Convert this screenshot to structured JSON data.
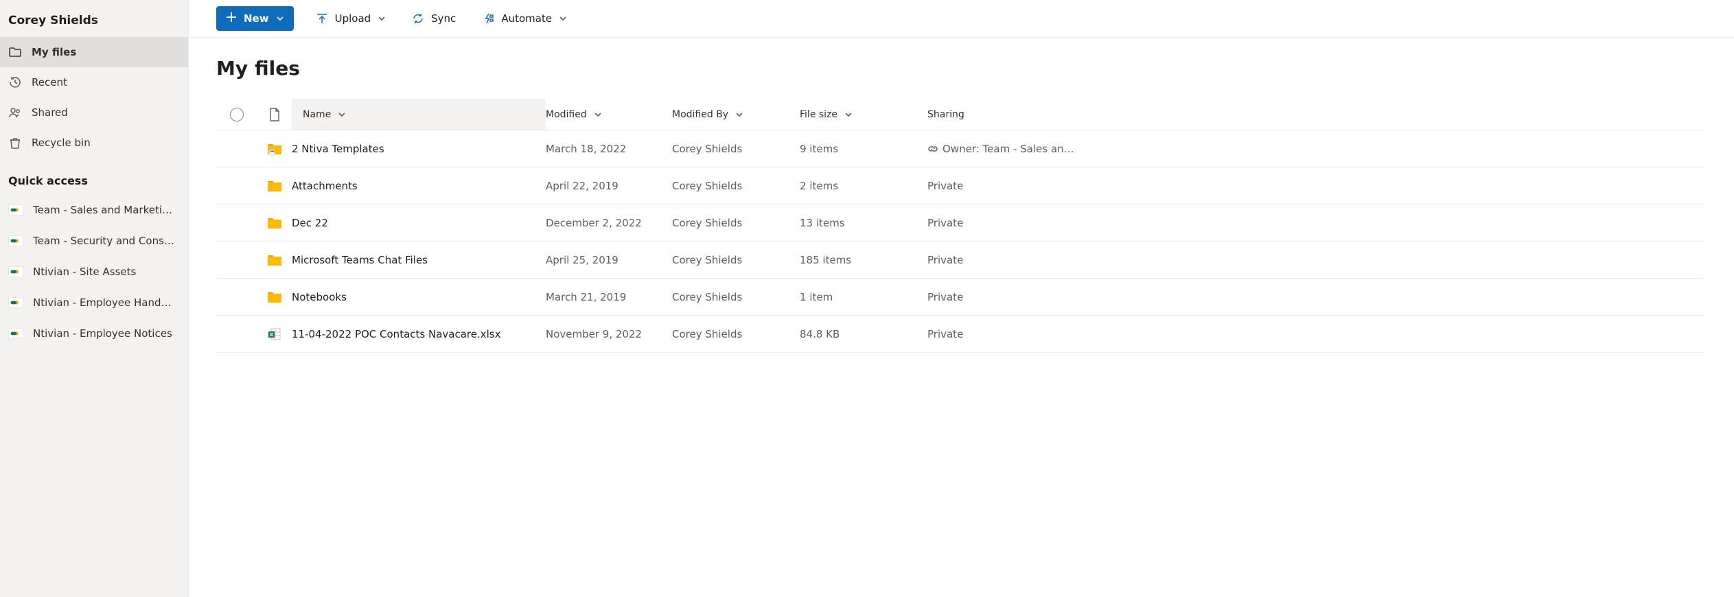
{
  "owner": "Corey Shields",
  "nav": {
    "items": [
      {
        "icon": "folder-outline",
        "label": "My files",
        "active": true
      },
      {
        "icon": "clock",
        "label": "Recent",
        "active": false
      },
      {
        "icon": "people",
        "label": "Shared",
        "active": false
      },
      {
        "icon": "trash",
        "label": "Recycle bin",
        "active": false
      }
    ]
  },
  "quick_access": {
    "header": "Quick access",
    "items": [
      {
        "label": "Team - Sales and Marketi…"
      },
      {
        "label": "Team - Security and Cons…"
      },
      {
        "label": "Ntivian - Site Assets"
      },
      {
        "label": "Ntivian - Employee Hand…"
      },
      {
        "label": "Ntivian - Employee Notices"
      }
    ]
  },
  "commands": {
    "new": "New",
    "upload": "Upload",
    "sync": "Sync",
    "automate": "Automate"
  },
  "page_title": "My files",
  "columns": {
    "name": "Name",
    "modified": "Modified",
    "modified_by": "Modified By",
    "file_size": "File size",
    "sharing": "Sharing"
  },
  "rows": [
    {
      "type": "folder-shared",
      "name": "2 Ntiva Templates",
      "modified": "March 18, 2022",
      "modified_by": "Corey Shields",
      "size": "9 items",
      "sharing": "Owner: Team - Sales an…",
      "sharing_icon": "link"
    },
    {
      "type": "folder",
      "name": "Attachments",
      "modified": "April 22, 2019",
      "modified_by": "Corey Shields",
      "size": "2 items",
      "sharing": "Private"
    },
    {
      "type": "folder",
      "name": "Dec 22",
      "modified": "December 2, 2022",
      "modified_by": "Corey Shields",
      "size": "13 items",
      "sharing": "Private"
    },
    {
      "type": "folder",
      "name": "Microsoft Teams Chat Files",
      "modified": "April 25, 2019",
      "modified_by": "Corey Shields",
      "size": "185 items",
      "sharing": "Private"
    },
    {
      "type": "folder",
      "name": "Notebooks",
      "modified": "March 21, 2019",
      "modified_by": "Corey Shields",
      "size": "1 item",
      "sharing": "Private"
    },
    {
      "type": "xlsx",
      "name": "11-04-2022 POC Contacts Navacare.xlsx",
      "modified": "November 9, 2022",
      "modified_by": "Corey Shields",
      "size": "84.8 KB",
      "sharing": "Private"
    }
  ]
}
